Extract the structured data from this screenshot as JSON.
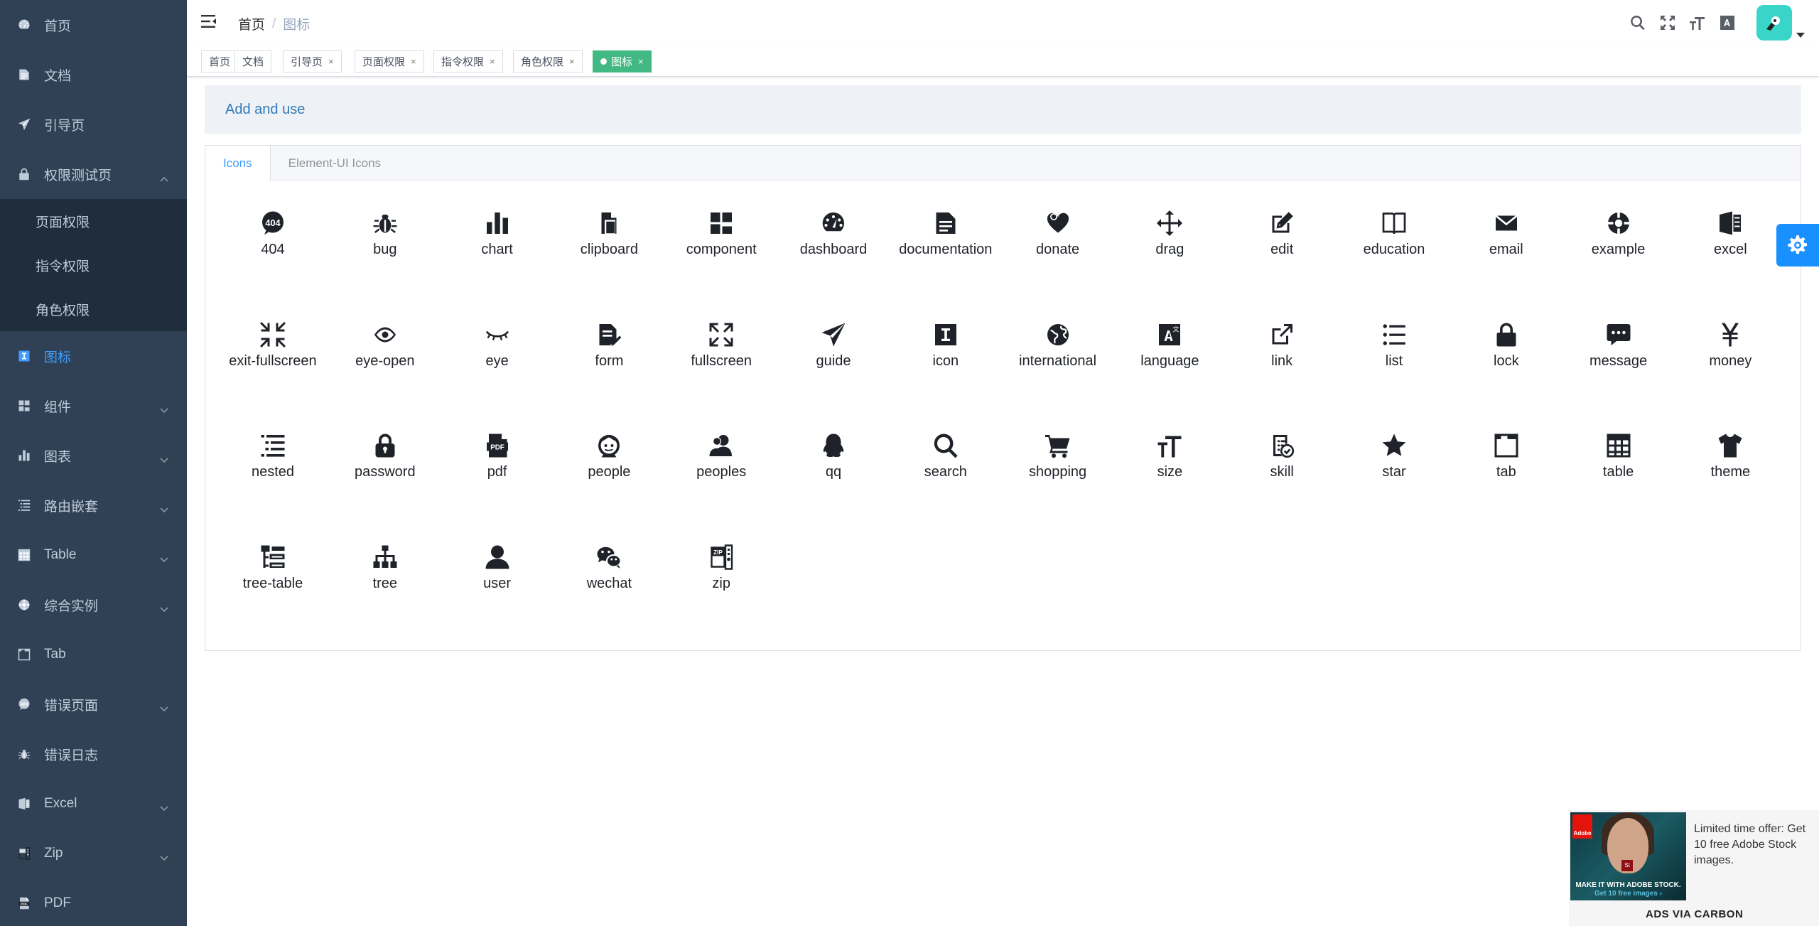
{
  "sidebar": {
    "items": [
      {
        "label": "首页",
        "icon": "dashboard-icon",
        "chevron": false
      },
      {
        "label": "文档",
        "icon": "documentation-icon",
        "chevron": false
      },
      {
        "label": "引导页",
        "icon": "guide-icon",
        "chevron": false
      },
      {
        "label": "权限测试页",
        "icon": "lock-icon",
        "chevron": true,
        "expanded": true
      },
      {
        "label": "图标",
        "icon": "icon-icon",
        "chevron": false,
        "active": true
      },
      {
        "label": "组件",
        "icon": "component-icon",
        "chevron": true
      },
      {
        "label": "图表",
        "icon": "chart-icon",
        "chevron": true
      },
      {
        "label": "路由嵌套",
        "icon": "nested-icon",
        "chevron": true
      },
      {
        "label": "Table",
        "icon": "table-icon",
        "chevron": true
      },
      {
        "label": "综合实例",
        "icon": "example-icon",
        "chevron": true
      },
      {
        "label": "Tab",
        "icon": "tab-icon",
        "chevron": false
      },
      {
        "label": "错误页面",
        "icon": "404-icon",
        "chevron": true
      },
      {
        "label": "错误日志",
        "icon": "bug-icon",
        "chevron": false
      },
      {
        "label": "Excel",
        "icon": "excel-icon",
        "chevron": true
      },
      {
        "label": "Zip",
        "icon": "zip-icon",
        "chevron": true
      },
      {
        "label": "PDF",
        "icon": "pdf-icon",
        "chevron": false
      }
    ],
    "permission_submenu": [
      "页面权限",
      "指令权限",
      "角色权限"
    ]
  },
  "header": {
    "breadcrumb": [
      "首页",
      "图标"
    ],
    "right_icons": [
      "search-icon",
      "fullscreen-icon",
      "size-icon",
      "language-icon"
    ]
  },
  "tags": [
    {
      "label": "首页",
      "closable": false
    },
    {
      "label": "文档",
      "closable": false
    },
    {
      "label": "引导页",
      "closable": true
    },
    {
      "label": "页面权限",
      "closable": true
    },
    {
      "label": "指令权限",
      "closable": true
    },
    {
      "label": "角色权限",
      "closable": true
    },
    {
      "label": "图标",
      "closable": true,
      "active": true
    }
  ],
  "tag_close_glyph": "×",
  "info_link": "Add and use",
  "tabs": [
    "Icons",
    "Element-UI Icons"
  ],
  "icons": [
    "404",
    "bug",
    "chart",
    "clipboard",
    "component",
    "dashboard",
    "documentation",
    "donate",
    "drag",
    "edit",
    "education",
    "email",
    "example",
    "excel",
    "exit-fullscreen",
    "eye-open",
    "eye",
    "form",
    "fullscreen",
    "guide",
    "icon",
    "international",
    "language",
    "link",
    "list",
    "lock",
    "message",
    "money",
    "nested",
    "password",
    "pdf",
    "people",
    "peoples",
    "qq",
    "search",
    "shopping",
    "size",
    "skill",
    "star",
    "tab",
    "table",
    "theme",
    "tree-table",
    "tree",
    "user",
    "wechat",
    "zip"
  ],
  "ad": {
    "image_caption_1": "MAKE IT WITH ADOBE STOCK.",
    "image_caption_2": "Get 10 free images ›",
    "brand": "Adobe",
    "brand_badge": "St",
    "text": "Limited time offer: Get 10 free Adobe Stock images.",
    "via": "ADS VIA CARBON"
  },
  "colors": {
    "sidebar_bg": "#304156",
    "submenu_bg": "#1f2d3d",
    "active_blue": "#409eff",
    "tag_active": "#42b983",
    "avatar": "#39d5c9",
    "settings_btn": "#1890ff"
  }
}
